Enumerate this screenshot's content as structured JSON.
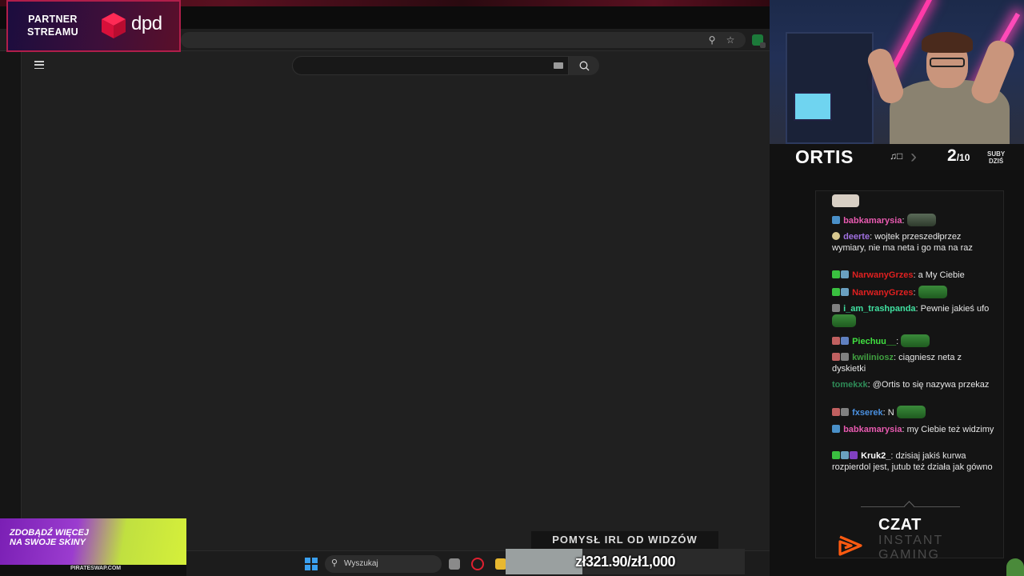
{
  "partner": {
    "line1": "PARTNER",
    "line2": "STREAMU",
    "brand": "dpd"
  },
  "browser": {
    "icons": {
      "zoom": "zoom-icon",
      "bookmark": "star-icon",
      "extension": "shield-extension-icon",
      "menu": "hamburger-icon",
      "search": "search-icon"
    },
    "search": {
      "placeholder": ""
    }
  },
  "streamer": {
    "name": "ORTIS",
    "subs_count": "2",
    "subs_total": "/10",
    "subs_label_1": "SUBY",
    "subs_label_2": "DZIŚ"
  },
  "chat": {
    "messages": [
      {
        "user": "babkamarysia",
        "color": "#e85ab0",
        "text": "",
        "emote": "dark",
        "badges": [
          "#4a90c8"
        ]
      },
      {
        "user": "deerte",
        "color": "#a070e0",
        "text": "wojtek przeszedłprzez wymiary, nie ma neta i go ma na raz",
        "emote": "",
        "badges": [
          "#d8c890"
        ]
      },
      {
        "user": "NarwanyGrzes",
        "color": "#e02020",
        "text": "a My Ciebie",
        "emote": "",
        "badges": [
          "#3ac040",
          "#6aa0c0"
        ]
      },
      {
        "user": "NarwanyGrzes",
        "color": "#e02020",
        "text": "",
        "emote": "green",
        "badges": [
          "#3ac040",
          "#6aa0c0"
        ]
      },
      {
        "user": "i_am_trashpanda",
        "color": "#40e0a0",
        "text": "Pewnie jakieś ufo",
        "emote": "green",
        "badges": [
          "#808080"
        ]
      },
      {
        "user": "Piechuu__",
        "color": "#40e040",
        "text": "",
        "emote": "green",
        "badges": [
          "#c06060",
          "#6080c0"
        ]
      },
      {
        "user": "kwiliniosz",
        "color": "#40a040",
        "text": "ciągniesz neta z dyskietki",
        "emote": "",
        "badges": [
          "#c06060",
          "#808080"
        ]
      },
      {
        "user": "tomekxk",
        "color": "#2e8b57",
        "text": "@Ortis to się nazywa przekaz",
        "emote": "",
        "badges": []
      },
      {
        "user": "fxserek",
        "color": "#4a90e0",
        "text": "N",
        "emote": "green",
        "badges": [
          "#c06060",
          "#808080"
        ]
      },
      {
        "user": "babkamarysia",
        "color": "#e85ab0",
        "text": "my Ciebie też widzimy",
        "emote": "",
        "badges": [
          "#4a90c8"
        ]
      },
      {
        "user": "Kruk2_",
        "color": "#ffffff",
        "text": "dzisiaj jakiś kurwa rozpierdol jest, jutub też działa jak gówno",
        "emote": "",
        "badges": [
          "#3ac040",
          "#6aa0c0",
          "#8040c0"
        ]
      }
    ],
    "footer_title": "CZAT",
    "footer_brand_1": "INSTANT",
    "footer_brand_2": "GAMING"
  },
  "ad": {
    "line1": "ZDOBĄDŹ WIĘCEJ",
    "line2": "NA SWOJE SKINY",
    "url": "PIRATESWAP.COM"
  },
  "taskbar": {
    "search_label": "Wyszukaj"
  },
  "donation": {
    "goal_title": "POMYSŁ IRL OD WIDZÓW",
    "amount_text": "zł321.90/zł1,000",
    "progress": 0.3219
  }
}
